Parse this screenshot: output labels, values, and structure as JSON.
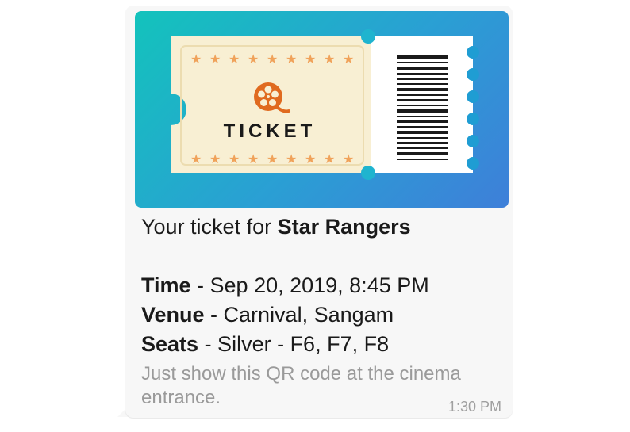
{
  "ticket_banner": {
    "ticket_word": "TICKET",
    "colors": {
      "gradient_start": "#13c3bc",
      "gradient_end": "#3e7fd9",
      "stub_fill": "#f8efd3",
      "star": "#f0a25a",
      "reel": "#e06a1f"
    },
    "icons": [
      "film-reel-icon",
      "star-icon",
      "barcode-icon"
    ]
  },
  "message": {
    "intro_prefix": "Your ticket for ",
    "movie_title": "Star Rangers",
    "time_label": "Time",
    "time_value": " - Sep 20, 2019, 8:45 PM",
    "venue_label": "Venue",
    "venue_value": " - Carnival, Sangam",
    "seats_label": "Seats",
    "seats_value": " - Silver - F6, F7, F8",
    "hint": "Just show this QR code at the cinema entrance.",
    "timestamp": "1:30 PM"
  }
}
